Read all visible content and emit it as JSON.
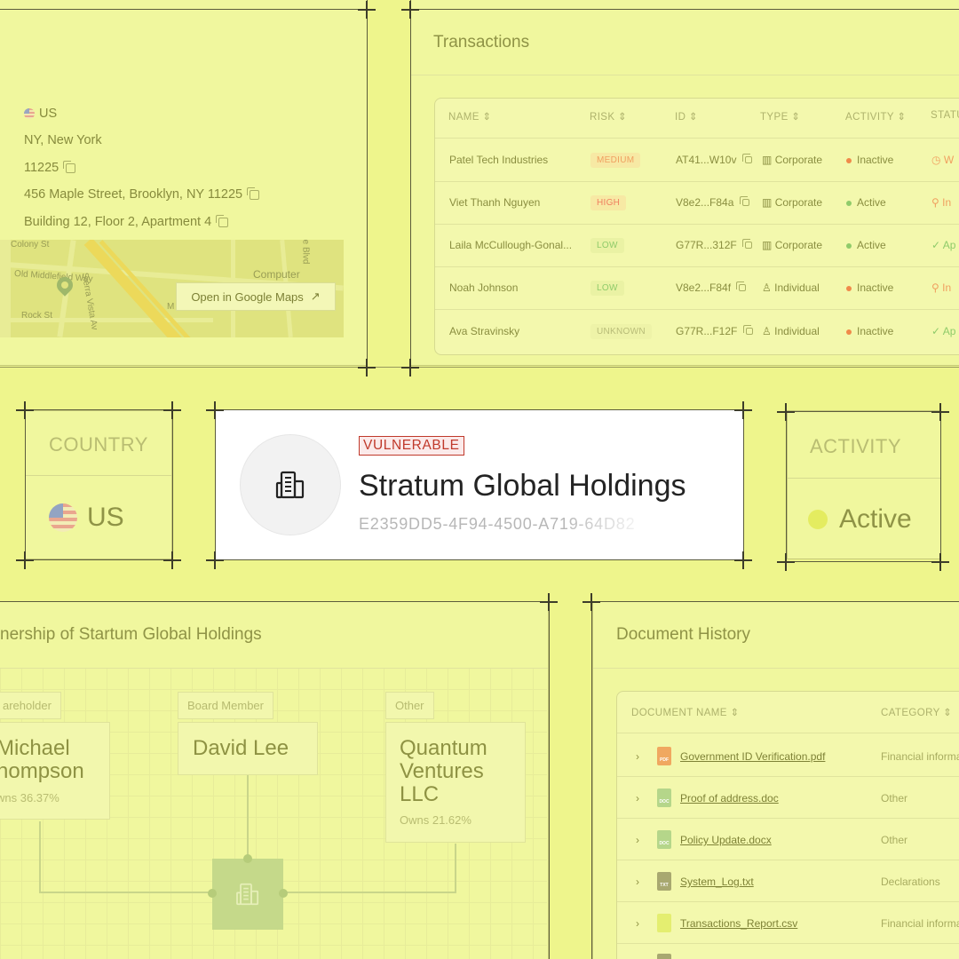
{
  "address": {
    "country": "US",
    "region": "NY, New York",
    "zip": "11225",
    "street": "456 Maple Street, Brooklyn, NY 11225",
    "unit": "Building 12, Floor 2, Apartment 4",
    "map_labels": [
      "Colony St",
      "Old Middlefield Way",
      "Computer",
      "Rock St",
      "Sierra Vista Av",
      "e Blvd",
      "M"
    ],
    "map_button": "Open in Google Maps",
    "map_button_icon": "arrow-up-right-icon"
  },
  "transactions": {
    "title": "Transactions",
    "columns": [
      "NAME",
      "RISK",
      "ID",
      "TYPE",
      "ACTIVITY",
      "STATU"
    ],
    "rows": [
      {
        "name": "Patel Tech Industries",
        "risk": "MEDIUM",
        "id": "AT41...W10v",
        "type": "Corporate",
        "activity": "Inactive",
        "status": "W"
      },
      {
        "name": "Viet Thanh Nguyen",
        "risk": "HIGH",
        "id": "V8e2...F84a",
        "type": "Corporate",
        "activity": "Active",
        "status": "In"
      },
      {
        "name": "Laila McCullough-Gonal...",
        "risk": "LOW",
        "id": "G77R...312F",
        "type": "Corporate",
        "activity": "Active",
        "status": "Ap"
      },
      {
        "name": "Noah Johnson",
        "risk": "LOW",
        "id": "V8e2...F84f",
        "type": "Individual",
        "activity": "Inactive",
        "status": "In"
      },
      {
        "name": "Ava Stravinsky",
        "risk": "UNKNOWN",
        "id": "G77R...F12F",
        "type": "Individual",
        "activity": "Inactive",
        "status": "Ap"
      }
    ],
    "colors": {
      "medium": "#f0a060",
      "high": "#f08060",
      "low": "#8fcb6a",
      "unknown": "#b8bc78",
      "active": "#8fcb6a",
      "inactive": "#f08a4a"
    }
  },
  "country_card": {
    "label": "COUNTRY",
    "value": "US"
  },
  "entity": {
    "badge": "VULNERABLE",
    "name": "Stratum Global Holdings",
    "id": "E2359DD5-4F94-4500-A719-64D82"
  },
  "activity_card": {
    "label": "ACTIVITY",
    "value": "Active"
  },
  "ownership": {
    "title": "nership of Startum Global Holdings",
    "owners": [
      {
        "role": "areholder",
        "name_line1": "Michael",
        "name_line2": "hompson",
        "pct": "wns 36.37%"
      },
      {
        "role": "Board Member",
        "name": "David Lee"
      },
      {
        "role": "Other",
        "name_line1": "Quantum",
        "name_line2": "Ventures",
        "name_line3": "LLC",
        "pct": "Owns 21.62%"
      }
    ]
  },
  "documents": {
    "title": "Document History",
    "columns": [
      "DOCUMENT NAME",
      "CATEGORY"
    ],
    "rows": [
      {
        "name": "Government ID Verification.pdf",
        "category": "Financial informa",
        "type": "PDF",
        "color": "#f0a860"
      },
      {
        "name": "Proof of address.doc",
        "category": "Other",
        "type": "DOC",
        "color": "#b5d68a"
      },
      {
        "name": "Policy Update.docx",
        "category": "Other",
        "type": "DOC",
        "color": "#b5d68a"
      },
      {
        "name": "System_Log.txt",
        "category": "Declarations",
        "type": "TXT",
        "color": "#a8a870"
      },
      {
        "name": "Transactions_Report.csv",
        "category": "Financial informa",
        "type": "CSV",
        "color": "#e4ee70"
      }
    ]
  }
}
